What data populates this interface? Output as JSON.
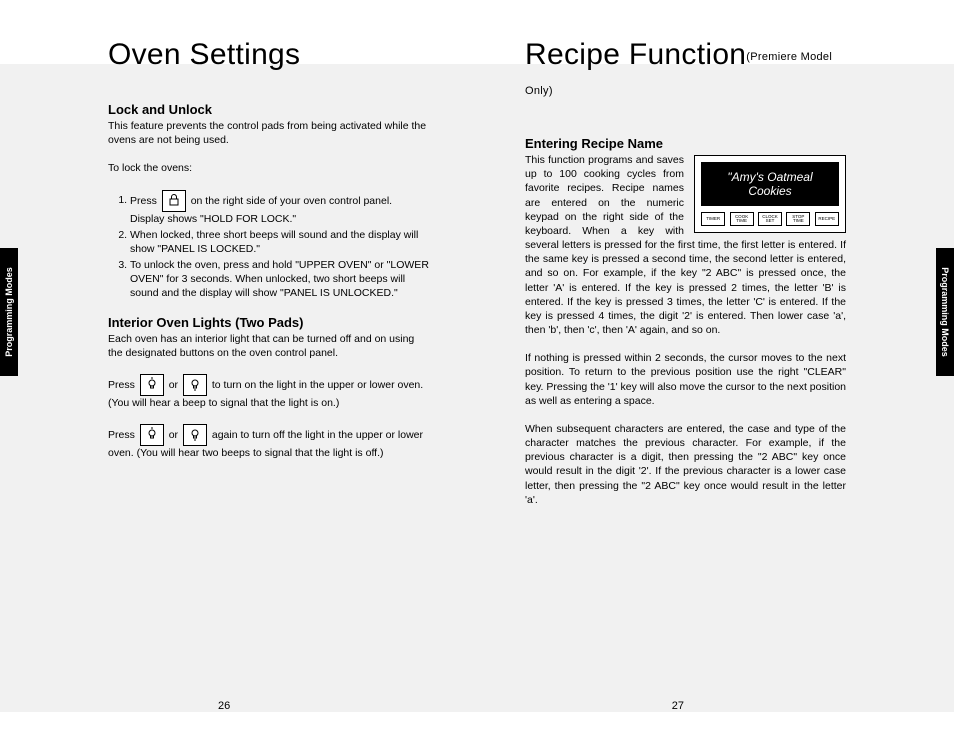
{
  "left": {
    "title": "Oven Settings",
    "h_lock": "Lock and Unlock",
    "lock_intro": "This feature prevents the control pads from being activated while the ovens are not being used.",
    "lock_lead": "To lock the ovens:",
    "lock_steps": [
      "on the right side of your oven control panel. Display shows \"HOLD FOR LOCK.\"",
      "When locked, three short beeps will sound and the display will show \"PANEL IS LOCKED.\"",
      "To unlock the oven, press and hold \"UPPER OVEN\" or \"LOWER OVEN\" for 3 seconds. When unlocked, two short beeps will sound and the display will show \"PANEL IS UNLOCKED.\""
    ],
    "press_word": "Press",
    "or_word": "or",
    "h_lights": "Interior Oven Lights (Two Pads)",
    "lights_intro": "Each oven has an interior light that can be turned off and on using the designated buttons on the oven control panel.",
    "lights_on_a": "Press",
    "lights_on_b": "to turn on the light in the upper or lower oven. (You will hear a beep to signal that the light is on.)",
    "lights_off_a": "Press",
    "lights_off_b": "again to turn off the light in the upper or lower oven. (You will hear two beeps to signal that the light is off.)"
  },
  "right": {
    "title": "Recipe Function",
    "subtitle": "(Premiere Model Only)",
    "h_enter": "Entering Recipe Name",
    "display_text": "\"Amy's Oatmeal Cookies",
    "btns": [
      "TIMER",
      "COOK TIME",
      "CLOCK SET",
      "STOP TIME",
      "RECIPE"
    ],
    "p1": "This function programs and saves up to 100 cooking cycles from favorite recipes. Recipe names are entered on the numeric keypad on the right side of the keyboard. When a key with several letters is pressed for the first time, the first letter is entered. If the same key is pressed a second time, the second letter is entered, and so on. For example, if the key \"2 ABC\" is pressed once, the letter 'A' is entered. If the key is pressed 2 times, the letter 'B' is entered. If the key is pressed 3 times, the letter 'C' is entered. If the key is pressed 4 times, the digit '2' is entered. Then lower case 'a', then 'b', then 'c', then 'A' again, and so on.",
    "p2": "If nothing is pressed within 2 seconds, the cursor moves to the next position. To return to the previous position use the right \"CLEAR\" key. Pressing the '1' key will also move the cursor to the next position as well as entering a space.",
    "p3": "When subsequent characters are entered, the case and type of the character matches the previous character. For example, if the previous character is a digit, then pressing the \"2 ABC\" key once would result in the digit '2'. If the previous character is a lower case letter, then pressing the \"2 ABC\" key once would result in the letter 'a'."
  },
  "tab": "Programming Modes",
  "page_l": "26",
  "page_r": "27"
}
